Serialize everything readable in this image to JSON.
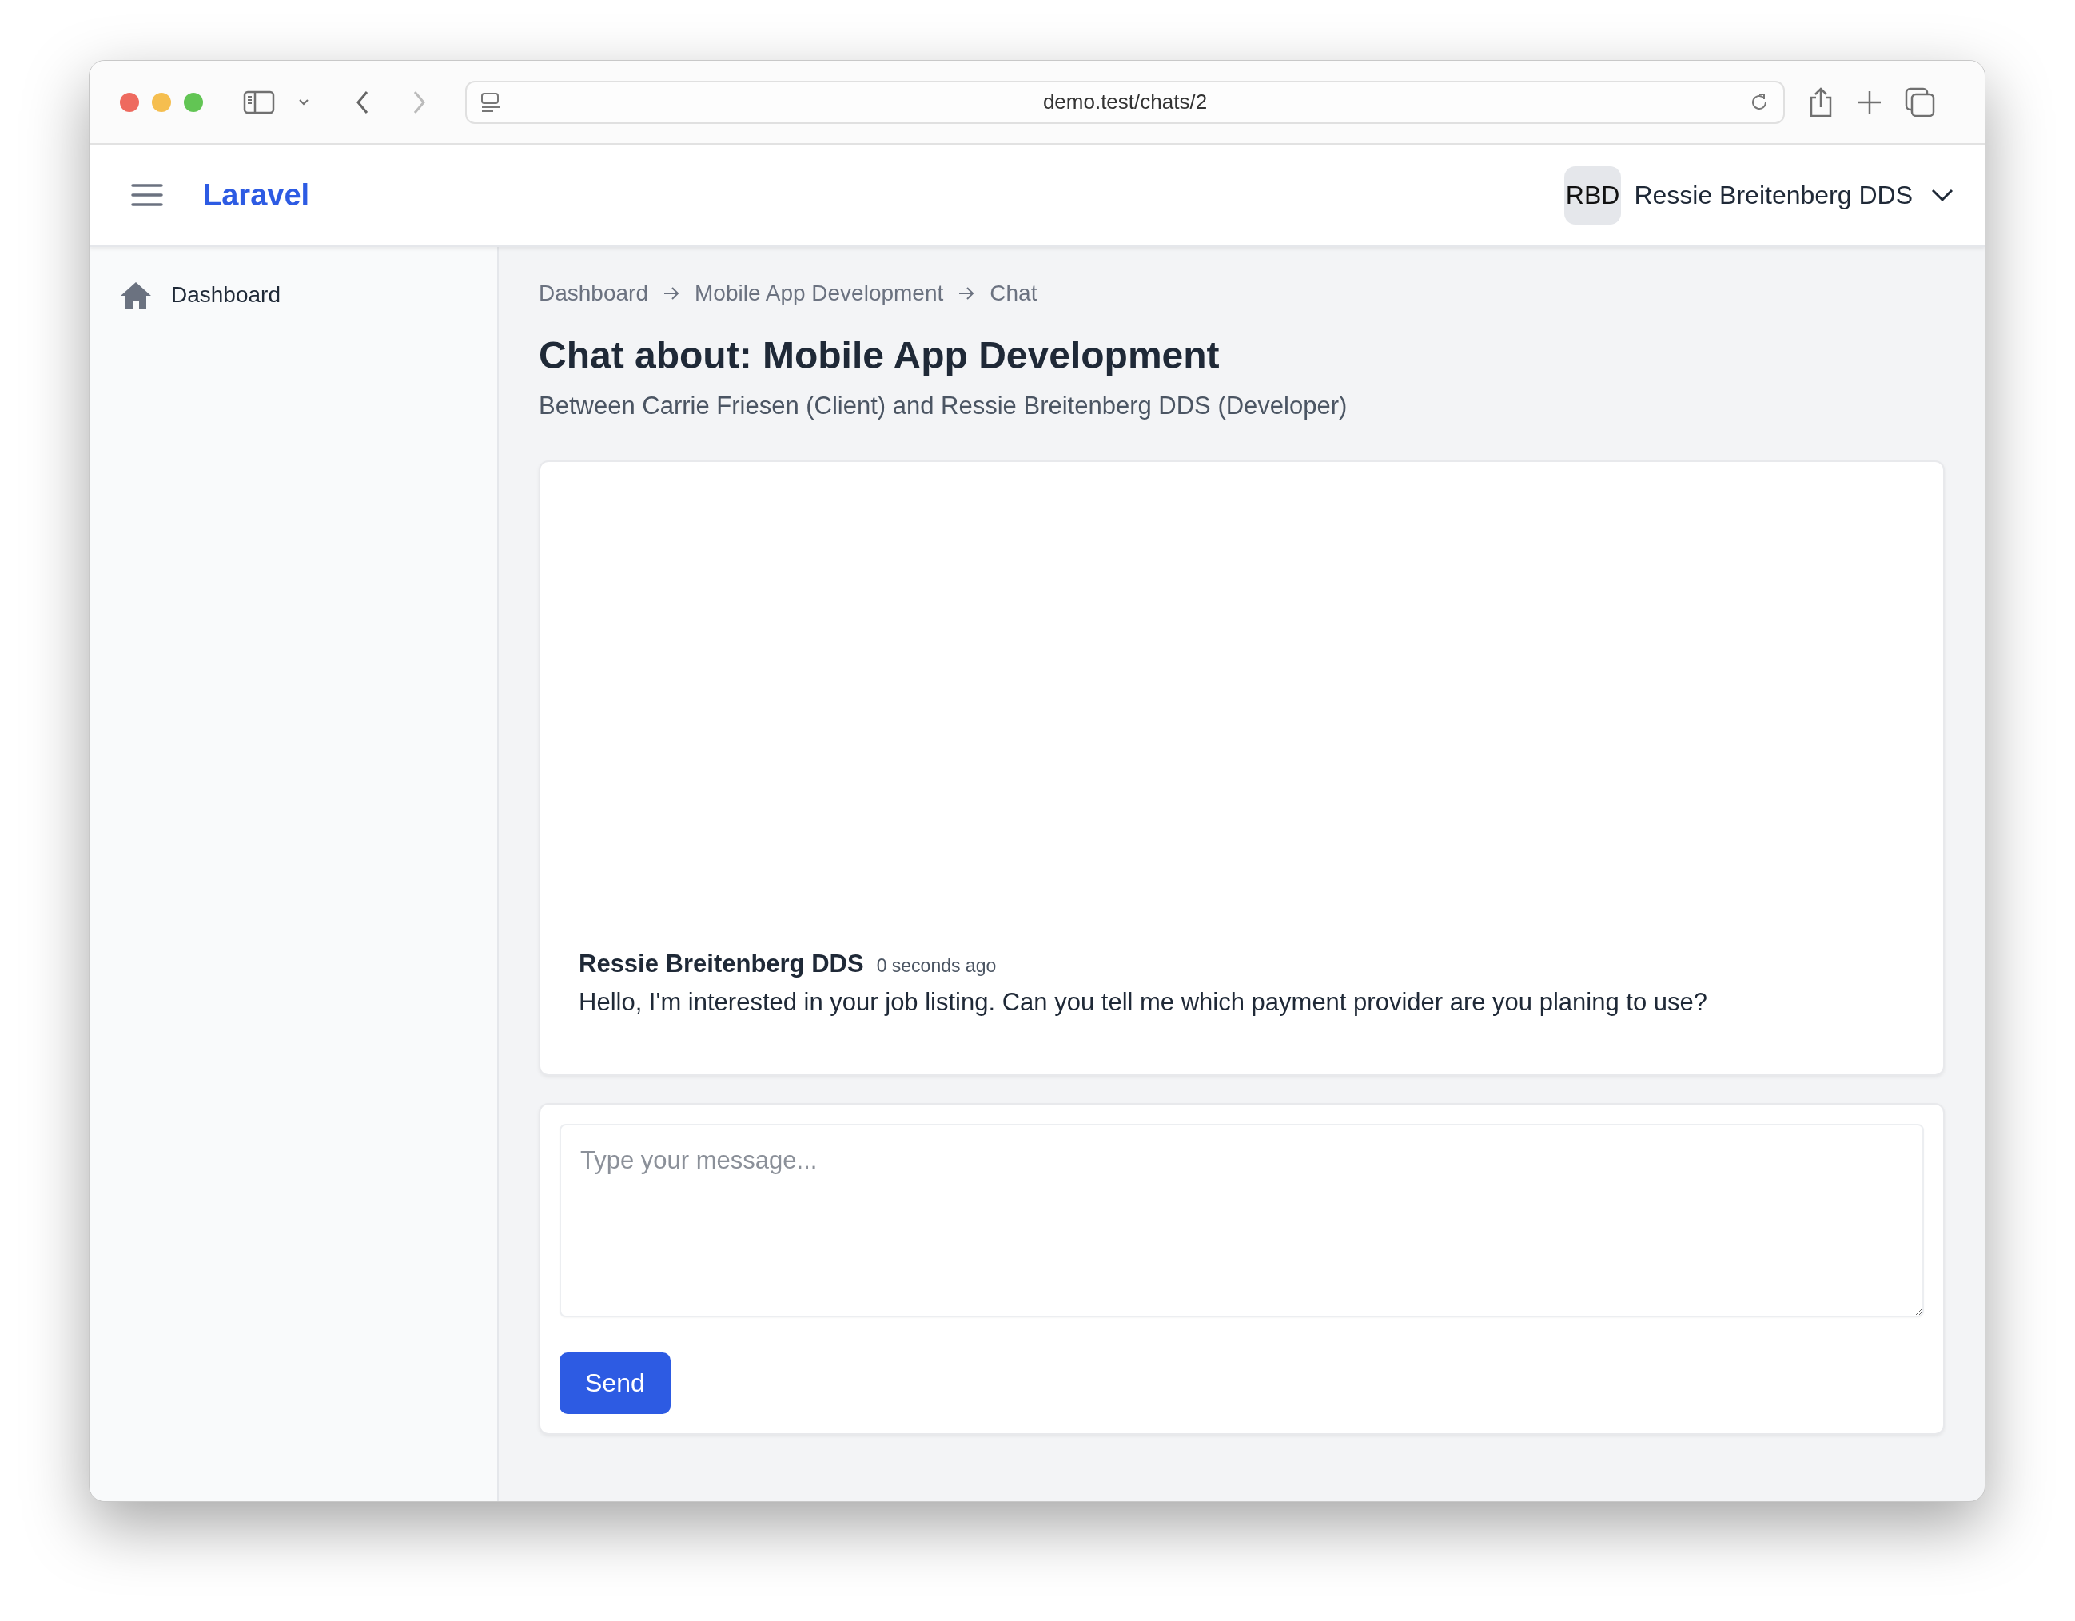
{
  "browser": {
    "url": "demo.test/chats/2"
  },
  "header": {
    "brand": "Laravel",
    "avatar_initials": "RBD",
    "user_name": "Ressie Breitenberg DDS"
  },
  "sidebar": {
    "items": [
      {
        "label": "Dashboard"
      }
    ]
  },
  "breadcrumb": [
    "Dashboard",
    "Mobile App Development",
    "Chat"
  ],
  "title": "Chat about: Mobile App Development",
  "subtitle": "Between Carrie Friesen (Client) and Ressie Breitenberg DDS (Developer)",
  "messages": [
    {
      "author": "Ressie Breitenberg DDS",
      "time": "0 seconds ago",
      "text": "Hello, I'm interested in your job listing. Can you tell me which payment provider are you planing to use?"
    }
  ],
  "composer": {
    "placeholder": "Type your message...",
    "button": "Send"
  }
}
